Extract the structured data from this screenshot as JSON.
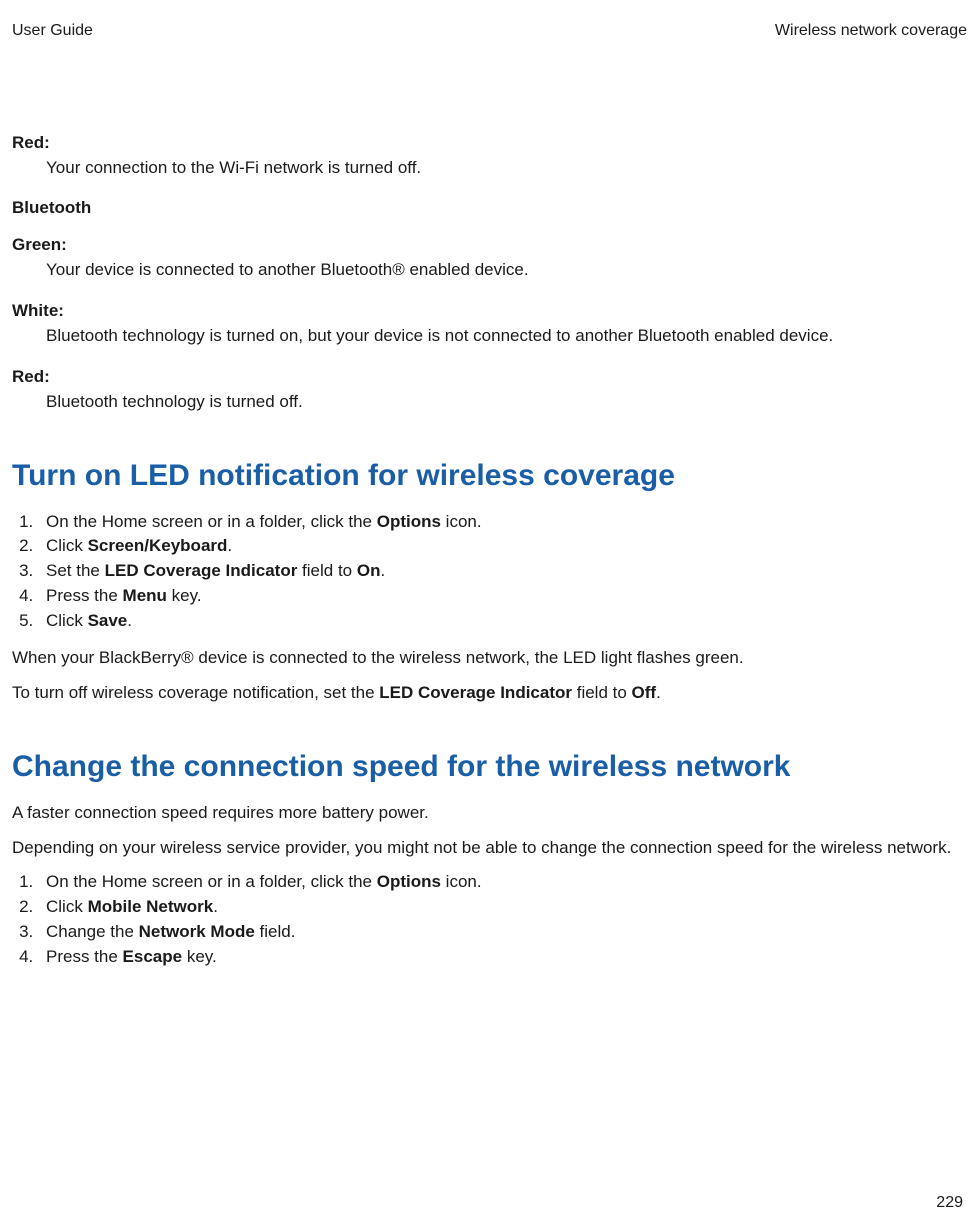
{
  "header": {
    "left": "User Guide",
    "right": "Wireless network coverage"
  },
  "wifi": {
    "red_label": "Red",
    "red_desc": "Your connection to the Wi-Fi network is turned off."
  },
  "bluetooth": {
    "heading": "Bluetooth",
    "green_label": "Green",
    "green_desc": "Your device is connected to another Bluetooth® enabled device.",
    "white_label": "White",
    "white_desc": "Bluetooth technology is turned on, but your device is not connected to another Bluetooth enabled device.",
    "red_label": "Red",
    "red_desc": "Bluetooth technology is turned off."
  },
  "section_led": {
    "title": "Turn on LED notification for wireless coverage",
    "step1_a": "On the Home screen or in a folder, click the ",
    "step1_b": "Options",
    "step1_c": " icon.",
    "step2_a": "Click ",
    "step2_b": "Screen/Keyboard",
    "step2_c": ".",
    "step3_a": "Set the ",
    "step3_b": "LED Coverage Indicator",
    "step3_c": " field to ",
    "step3_d": "On",
    "step3_e": ".",
    "step4_a": "Press the ",
    "step4_b": "Menu",
    "step4_c": " key.",
    "step5_a": "Click ",
    "step5_b": "Save",
    "step5_c": ".",
    "after1": "When your BlackBerry® device is connected to the wireless network, the LED light flashes green.",
    "after2_a": "To turn off wireless coverage notification, set the ",
    "after2_b": "LED Coverage Indicator",
    "after2_c": " field to ",
    "after2_d": "Off",
    "after2_e": "."
  },
  "section_speed": {
    "title": "Change the connection speed for the wireless network",
    "intro1": "A faster connection speed requires more battery power.",
    "intro2": "Depending on your wireless service provider, you might not be able to change the connection speed for the wireless network.",
    "step1_a": "On the Home screen or in a folder, click the ",
    "step1_b": "Options",
    "step1_c": " icon.",
    "step2_a": "Click ",
    "step2_b": "Mobile Network",
    "step2_c": ".",
    "step3_a": "Change the ",
    "step3_b": "Network Mode",
    "step3_c": " field.",
    "step4_a": "Press the ",
    "step4_b": "Escape",
    "step4_c": " key."
  },
  "page_number": "229"
}
